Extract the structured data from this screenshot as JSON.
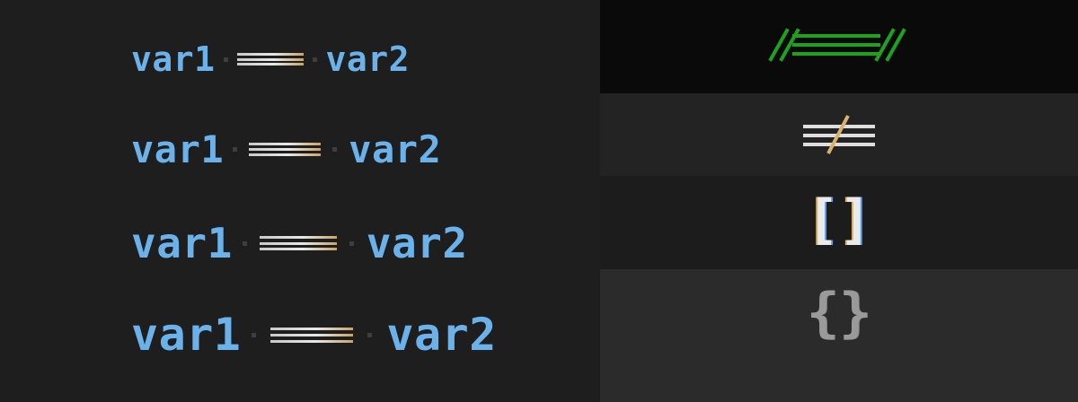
{
  "code_samples": [
    {
      "left": "var1",
      "right": "var2"
    },
    {
      "left": "var1",
      "right": "var2"
    },
    {
      "left": "var1",
      "right": "var2"
    },
    {
      "left": "var1",
      "right": "var2"
    }
  ],
  "glyphs": {
    "ligature_1": "triple-equals-slashed-icon",
    "ligature_2": "not-equal-triple-icon",
    "brackets": "[]",
    "braces": "{}"
  },
  "colors": {
    "identifier": "#6cb2ea",
    "operator": "#e8e8e8",
    "highlight_green": "#1fa01f",
    "background": "#1e1e1e"
  }
}
